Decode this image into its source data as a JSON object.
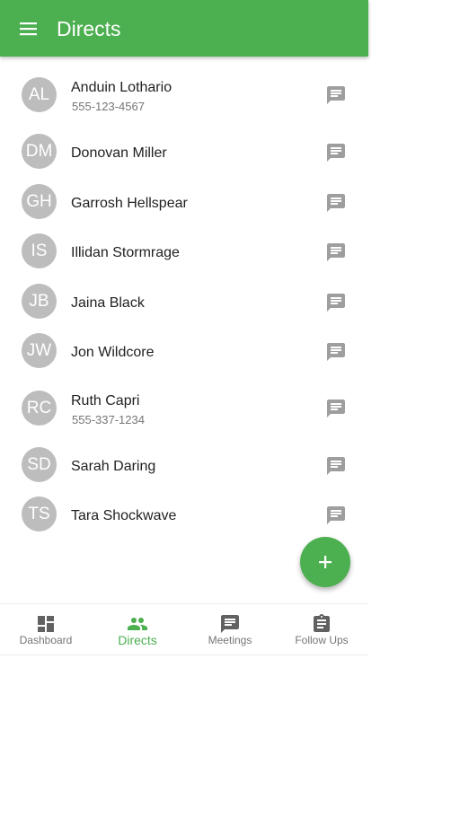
{
  "colors": {
    "primary": "#4caf50",
    "avatar": "#bdbdbd",
    "icon_muted": "#9e9e9e",
    "nav_icon": "#616161"
  },
  "header": {
    "title": "Directs",
    "menu_icon": "menu-icon"
  },
  "contacts": [
    {
      "initials": "AL",
      "name": "Anduin Lothario",
      "phone": "555-123-4567"
    },
    {
      "initials": "DM",
      "name": "Donovan Miller"
    },
    {
      "initials": "GH",
      "name": "Garrosh Hellspear"
    },
    {
      "initials": "IS",
      "name": "Illidan Stormrage"
    },
    {
      "initials": "JB",
      "name": "Jaina Black"
    },
    {
      "initials": "JW",
      "name": "Jon Wildcore"
    },
    {
      "initials": "RC",
      "name": "Ruth Capri",
      "phone": "555-337-1234"
    },
    {
      "initials": "SD",
      "name": "Sarah Daring"
    },
    {
      "initials": "TS",
      "name": "Tara Shockwave"
    }
  ],
  "fab": {
    "icon": "plus-icon"
  },
  "bottom_nav": [
    {
      "label": "Dashboard",
      "icon": "dashboard-icon",
      "active": false
    },
    {
      "label": "Directs",
      "icon": "people-icon",
      "active": true
    },
    {
      "label": "Meetings",
      "icon": "chat-icon",
      "active": false
    },
    {
      "label": "Follow Ups",
      "icon": "clipboard-icon",
      "active": false
    }
  ]
}
